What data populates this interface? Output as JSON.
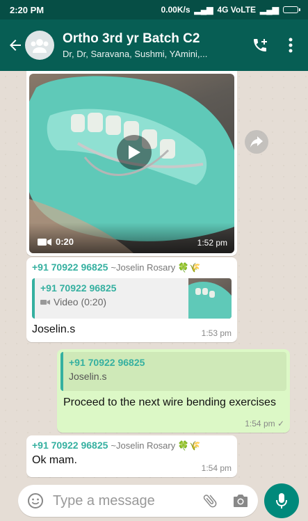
{
  "status_bar": {
    "time": "2:20 PM",
    "net_speed": "0.00K/s",
    "network": "4G VoLTE"
  },
  "header": {
    "title": "Ortho 3rd yr Batch C2",
    "members": "Dr, Dr, Saravana, Sushmi, YAmini,...",
    "icons": [
      "back-arrow-icon",
      "group-avatar-icon",
      "add-call-icon",
      "more-vert-icon"
    ]
  },
  "messages": {
    "video": {
      "duration": "0:20",
      "time": "1:52 pm"
    },
    "m1": {
      "sender": "+91 70922 96825",
      "alias": "~Joselin Rosary 🍀🌾",
      "quote_sender": "+91 70922 96825",
      "quote_text": "Video (0:20)",
      "text": "Joselin.s",
      "time": "1:53 pm"
    },
    "m2": {
      "quote_sender": "+91 70922 96825",
      "quote_text": "Joselin.s",
      "text": "Proceed to the next wire bending exercises",
      "time": "1:54 pm ✓"
    },
    "m3": {
      "sender": "+91 70922 96825",
      "alias": "~Joselin Rosary 🍀🌾",
      "text": "Ok mam.",
      "time": "1:54 pm"
    }
  },
  "input": {
    "placeholder": "Type a message"
  },
  "colors": {
    "header": "#075e54",
    "status": "#064e45",
    "outgoing": "#dcf8c6",
    "accent": "#35b0a0",
    "mic": "#00897b"
  }
}
